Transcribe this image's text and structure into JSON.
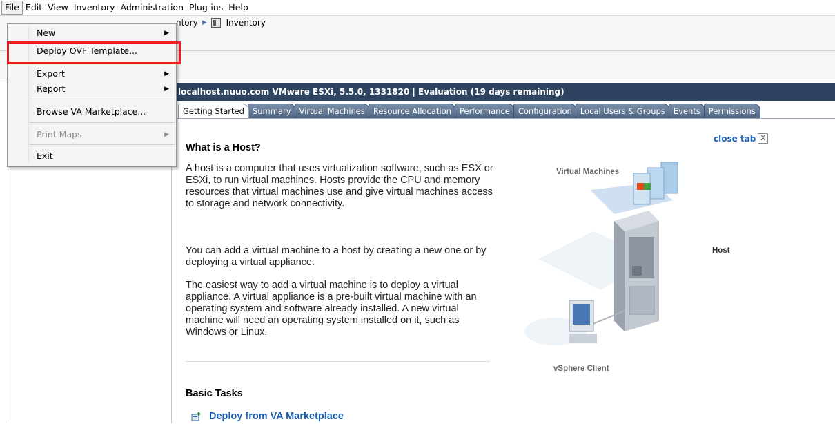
{
  "menubar": {
    "items": [
      "File",
      "Edit",
      "View",
      "Inventory",
      "Administration",
      "Plug-ins",
      "Help"
    ]
  },
  "file_menu": {
    "items": [
      {
        "label": "New",
        "submenu": true,
        "enabled": true
      },
      {
        "label": "Deploy OVF Template...",
        "submenu": false,
        "enabled": true
      },
      {
        "label": "Export",
        "submenu": true,
        "enabled": true
      },
      {
        "label": "Report",
        "submenu": true,
        "enabled": true
      },
      {
        "label": "Browse VA Marketplace...",
        "submenu": false,
        "enabled": true
      },
      {
        "label": "Print Maps",
        "submenu": true,
        "enabled": false
      },
      {
        "label": "Exit",
        "submenu": false,
        "enabled": true
      }
    ],
    "highlight_color": "#ee1c1c"
  },
  "breadcrumb": {
    "items": [
      "ntory",
      "Inventory"
    ]
  },
  "host": {
    "header": "localhost.nuuo.com VMware ESXi, 5.5.0, 1331820 | Evaluation (19 days remaining)",
    "header_color": "#2e4360"
  },
  "tabs": [
    "Getting Started",
    "Summary",
    "Virtual Machines",
    "Resource Allocation",
    "Performance",
    "Configuration",
    "Local Users & Groups",
    "Events",
    "Permissions"
  ],
  "content": {
    "close_tab": "close tab",
    "close_box": "X",
    "heading": "What is a Host?",
    "paragraphs": [
      "A host is a computer that uses virtualization software, such as ESX or ESXi, to run virtual machines. Hosts provide the CPU and memory resources that virtual machines use and give virtual machines access to storage and network connectivity.",
      "You can add a virtual machine to a host by creating a new one or by deploying a virtual appliance.",
      "The easiest way to add a virtual machine is to deploy a virtual appliance. A virtual appliance is a pre-built virtual machine with an operating system and software already installed. A new virtual machine will need an operating system installed on it, such as Windows or Linux."
    ],
    "basic_tasks_heading": "Basic Tasks",
    "task_link": "Deploy from VA Marketplace"
  },
  "diagram": {
    "virtual_machines_label": "Virtual Machines",
    "host_label": "Host",
    "client_label": "vSphere Client"
  },
  "icons": {
    "breadcrumb_arrow": "triangle-right-icon",
    "inventory": "inventory-icon",
    "task": "deploy-icon",
    "submenu": "chevron-right-icon"
  }
}
